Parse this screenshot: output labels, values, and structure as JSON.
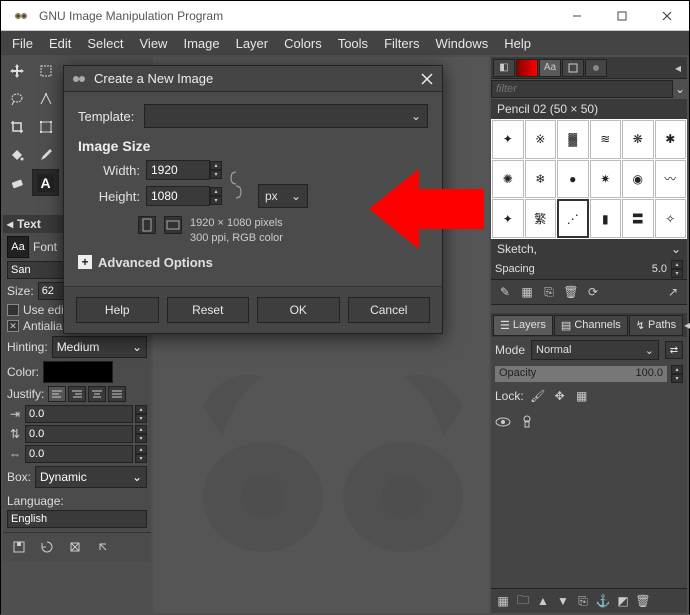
{
  "window": {
    "title": "GNU Image Manipulation Program"
  },
  "menu": [
    "File",
    "Edit",
    "Select",
    "View",
    "Image",
    "Layer",
    "Colors",
    "Tools",
    "Filters",
    "Windows",
    "Help"
  ],
  "tool_options": {
    "panel_title": "Text",
    "font_label": "Font",
    "font_value": "San",
    "size_label": "Size:",
    "size_value": "62",
    "use_editor_label": "Use editor",
    "use_editor_checked": false,
    "antialias_label": "Antialiasing",
    "antialias_checked": true,
    "hinting_label": "Hinting:",
    "hinting_value": "Medium",
    "color_label": "Color:",
    "justify_label": "Justify:",
    "indent_values": [
      "0.0",
      "0.0",
      "0.0"
    ],
    "box_label": "Box:",
    "box_value": "Dynamic",
    "language_label": "Language:",
    "language_value": "English"
  },
  "dialog": {
    "title": "Create a New Image",
    "template_label": "Template:",
    "section": "Image Size",
    "width_label": "Width:",
    "width_value": "1920",
    "height_label": "Height:",
    "height_value": "1080",
    "unit": "px",
    "info_line1": "1920 × 1080 pixels",
    "info_line2": "300 ppi, RGB color",
    "advanced": "Advanced Options",
    "buttons": {
      "help": "Help",
      "reset": "Reset",
      "ok": "OK",
      "cancel": "Cancel"
    }
  },
  "brushes": {
    "filter_placeholder": "filter",
    "selected_name": "Pencil 02 (50 × 50)",
    "category": "Sketch,",
    "spacing_label": "Spacing",
    "spacing_value": "5.0"
  },
  "layers": {
    "tabs": {
      "layers": "Layers",
      "channels": "Channels",
      "paths": "Paths"
    },
    "mode_label": "Mode",
    "mode_value": "Normal",
    "opacity_label": "Opacity",
    "opacity_value": "100.0",
    "lock_label": "Lock:"
  }
}
